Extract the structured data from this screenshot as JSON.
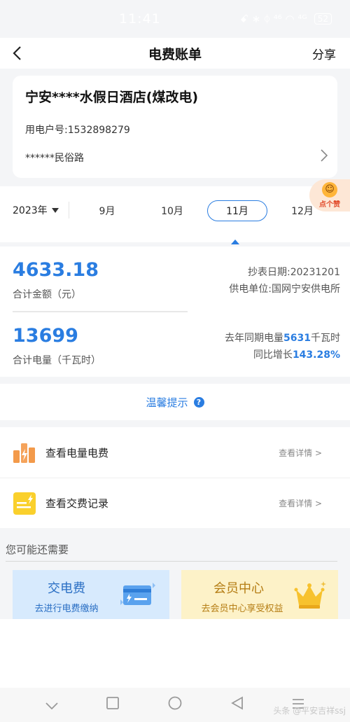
{
  "status_bar": {
    "time": "11:41",
    "indicators": "ꗃ ∗ ᛰ ⁴⁶ ◠ ⁴ᴳ",
    "battery": "52"
  },
  "nav": {
    "title": "电费账单",
    "share": "分享",
    "back_icon": "back-chevron-icon"
  },
  "account": {
    "name": "宁安****水假日酒店(煤改电)",
    "number": "用电户号:1532898279",
    "address": "******民俗路"
  },
  "months": {
    "year": "2023年",
    "tabs": [
      "9月",
      "10月",
      "11月",
      "12月"
    ],
    "selected": "11月"
  },
  "like_badge": {
    "text": "点个赞"
  },
  "bill": {
    "amount": "4633.18",
    "amount_label": "合计金额（元）",
    "usage": "13699",
    "usage_label": "合计电量（千瓦时）",
    "read_date": "抄表日期:20231201",
    "supplier": "供电单位:国网宁安供电所",
    "last_year_prefix": "去年同期电量",
    "last_year_value": "5631",
    "last_year_unit": "千瓦时",
    "yoy_prefix": "同比增长",
    "yoy_value": "143.28%"
  },
  "tip": {
    "text": "温馨提示",
    "icon": "help-icon"
  },
  "links": [
    {
      "label": "查看电量电费",
      "more": "查看详情 >",
      "icon": "bar-chart-icon"
    },
    {
      "label": "查看交费记录",
      "more": "查看详情 >",
      "icon": "payment-record-icon"
    }
  ],
  "section_title": "您可能还需要",
  "promos": {
    "pay": {
      "title": "交电费",
      "subtitle": "去进行电费缴纳"
    },
    "vip": {
      "title": "会员中心",
      "subtitle": "去会员中心享受权益"
    }
  },
  "watermark": "头条 @平安吉祥ssj",
  "colors": {
    "accent": "#2a7de1",
    "background": "#f4f5f7",
    "promo_pay_bg": "#d7eafd",
    "promo_vip_bg": "#fdf2c8"
  }
}
